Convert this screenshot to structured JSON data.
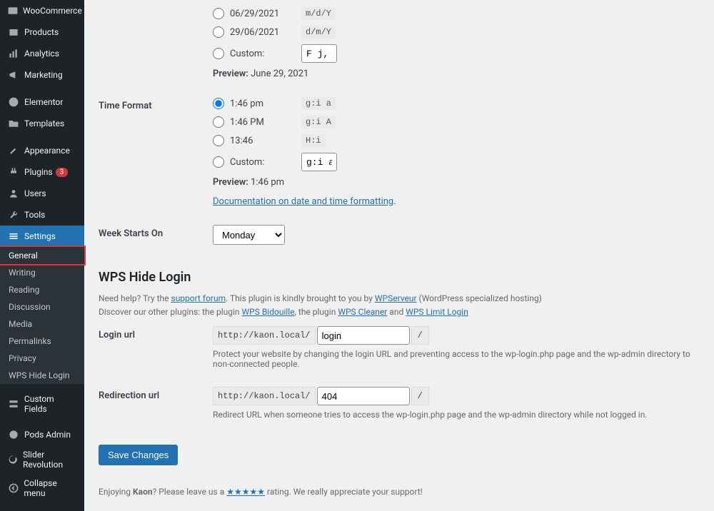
{
  "sidebar": {
    "items": [
      {
        "label": "WooCommerce",
        "icon": "woo"
      },
      {
        "label": "Products",
        "icon": "box"
      },
      {
        "label": "Analytics",
        "icon": "chart"
      },
      {
        "label": "Marketing",
        "icon": "megaphone"
      },
      {
        "label": "Elementor",
        "icon": "elementor"
      },
      {
        "label": "Templates",
        "icon": "folder"
      },
      {
        "label": "Appearance",
        "icon": "brush"
      },
      {
        "label": "Plugins",
        "icon": "plug",
        "badge": "3"
      },
      {
        "label": "Users",
        "icon": "user"
      },
      {
        "label": "Tools",
        "icon": "wrench"
      },
      {
        "label": "Settings",
        "icon": "sliders",
        "active": true
      },
      {
        "label": "Custom Fields",
        "icon": "fields"
      },
      {
        "label": "Pods Admin",
        "icon": "pods"
      },
      {
        "label": "Slider Revolution",
        "icon": "refresh"
      },
      {
        "label": "Collapse menu",
        "icon": "collapse"
      }
    ],
    "submenu": [
      {
        "label": "General",
        "current": true
      },
      {
        "label": "Writing"
      },
      {
        "label": "Reading"
      },
      {
        "label": "Discussion"
      },
      {
        "label": "Media"
      },
      {
        "label": "Permalinks"
      },
      {
        "label": "Privacy"
      },
      {
        "label": "WPS Hide Login"
      }
    ]
  },
  "date_format": {
    "opts": [
      {
        "label": "06/29/2021",
        "code": "m/d/Y"
      },
      {
        "label": "29/06/2021",
        "code": "d/m/Y"
      },
      {
        "label": "Custom:",
        "input": "F j, Y"
      }
    ],
    "preview_label": "Preview:",
    "preview_value": "June 29, 2021"
  },
  "time_format": {
    "heading": "Time Format",
    "opts": [
      {
        "label": "1:46 pm",
        "code": "g:i a",
        "checked": true
      },
      {
        "label": "1:46 PM",
        "code": "g:i A"
      },
      {
        "label": "13:46",
        "code": "H:i"
      },
      {
        "label": "Custom:",
        "input": "g:i a"
      }
    ],
    "preview_label": "Preview:",
    "preview_value": "1:46 pm",
    "doc_link": "Documentation on date and time formatting"
  },
  "week": {
    "heading": "Week Starts On",
    "value": "Monday"
  },
  "wps": {
    "heading": "WPS Hide Login",
    "help_pre": "Need help? Try the ",
    "help_link": "support forum",
    "help_mid": ". This plugin is kindly brought to you by ",
    "help_link2": "WPServeur",
    "help_post": " (WordPress specialized hosting)",
    "discover_pre": "Discover our other plugins: the plugin ",
    "discover1": "WPS Bidouille",
    "discover_mid1": ", the plugin ",
    "discover2": "WPS Cleaner",
    "discover_mid2": " and ",
    "discover3": "WPS Limit Login",
    "login": {
      "label": "Login url",
      "prefix": "http://kaon.local/",
      "value": "login",
      "suffix": "/",
      "helper": "Protect your website by changing the login URL and preventing access to the wp-login.php page and the wp-admin directory to non-connected people."
    },
    "redirect": {
      "label": "Redirection url",
      "prefix": "http://kaon.local/",
      "value": "404",
      "suffix": "/",
      "helper": "Redirect URL when someone tries to access the wp-login.php page and the wp-admin directory while not logged in."
    }
  },
  "save_label": "Save Changes",
  "footer": {
    "pre": "Enjoying ",
    "brand": "Kaon",
    "mid": "? Please leave us a ",
    "stars": "★★★★★",
    "post": " rating. We really appreciate your support!"
  }
}
